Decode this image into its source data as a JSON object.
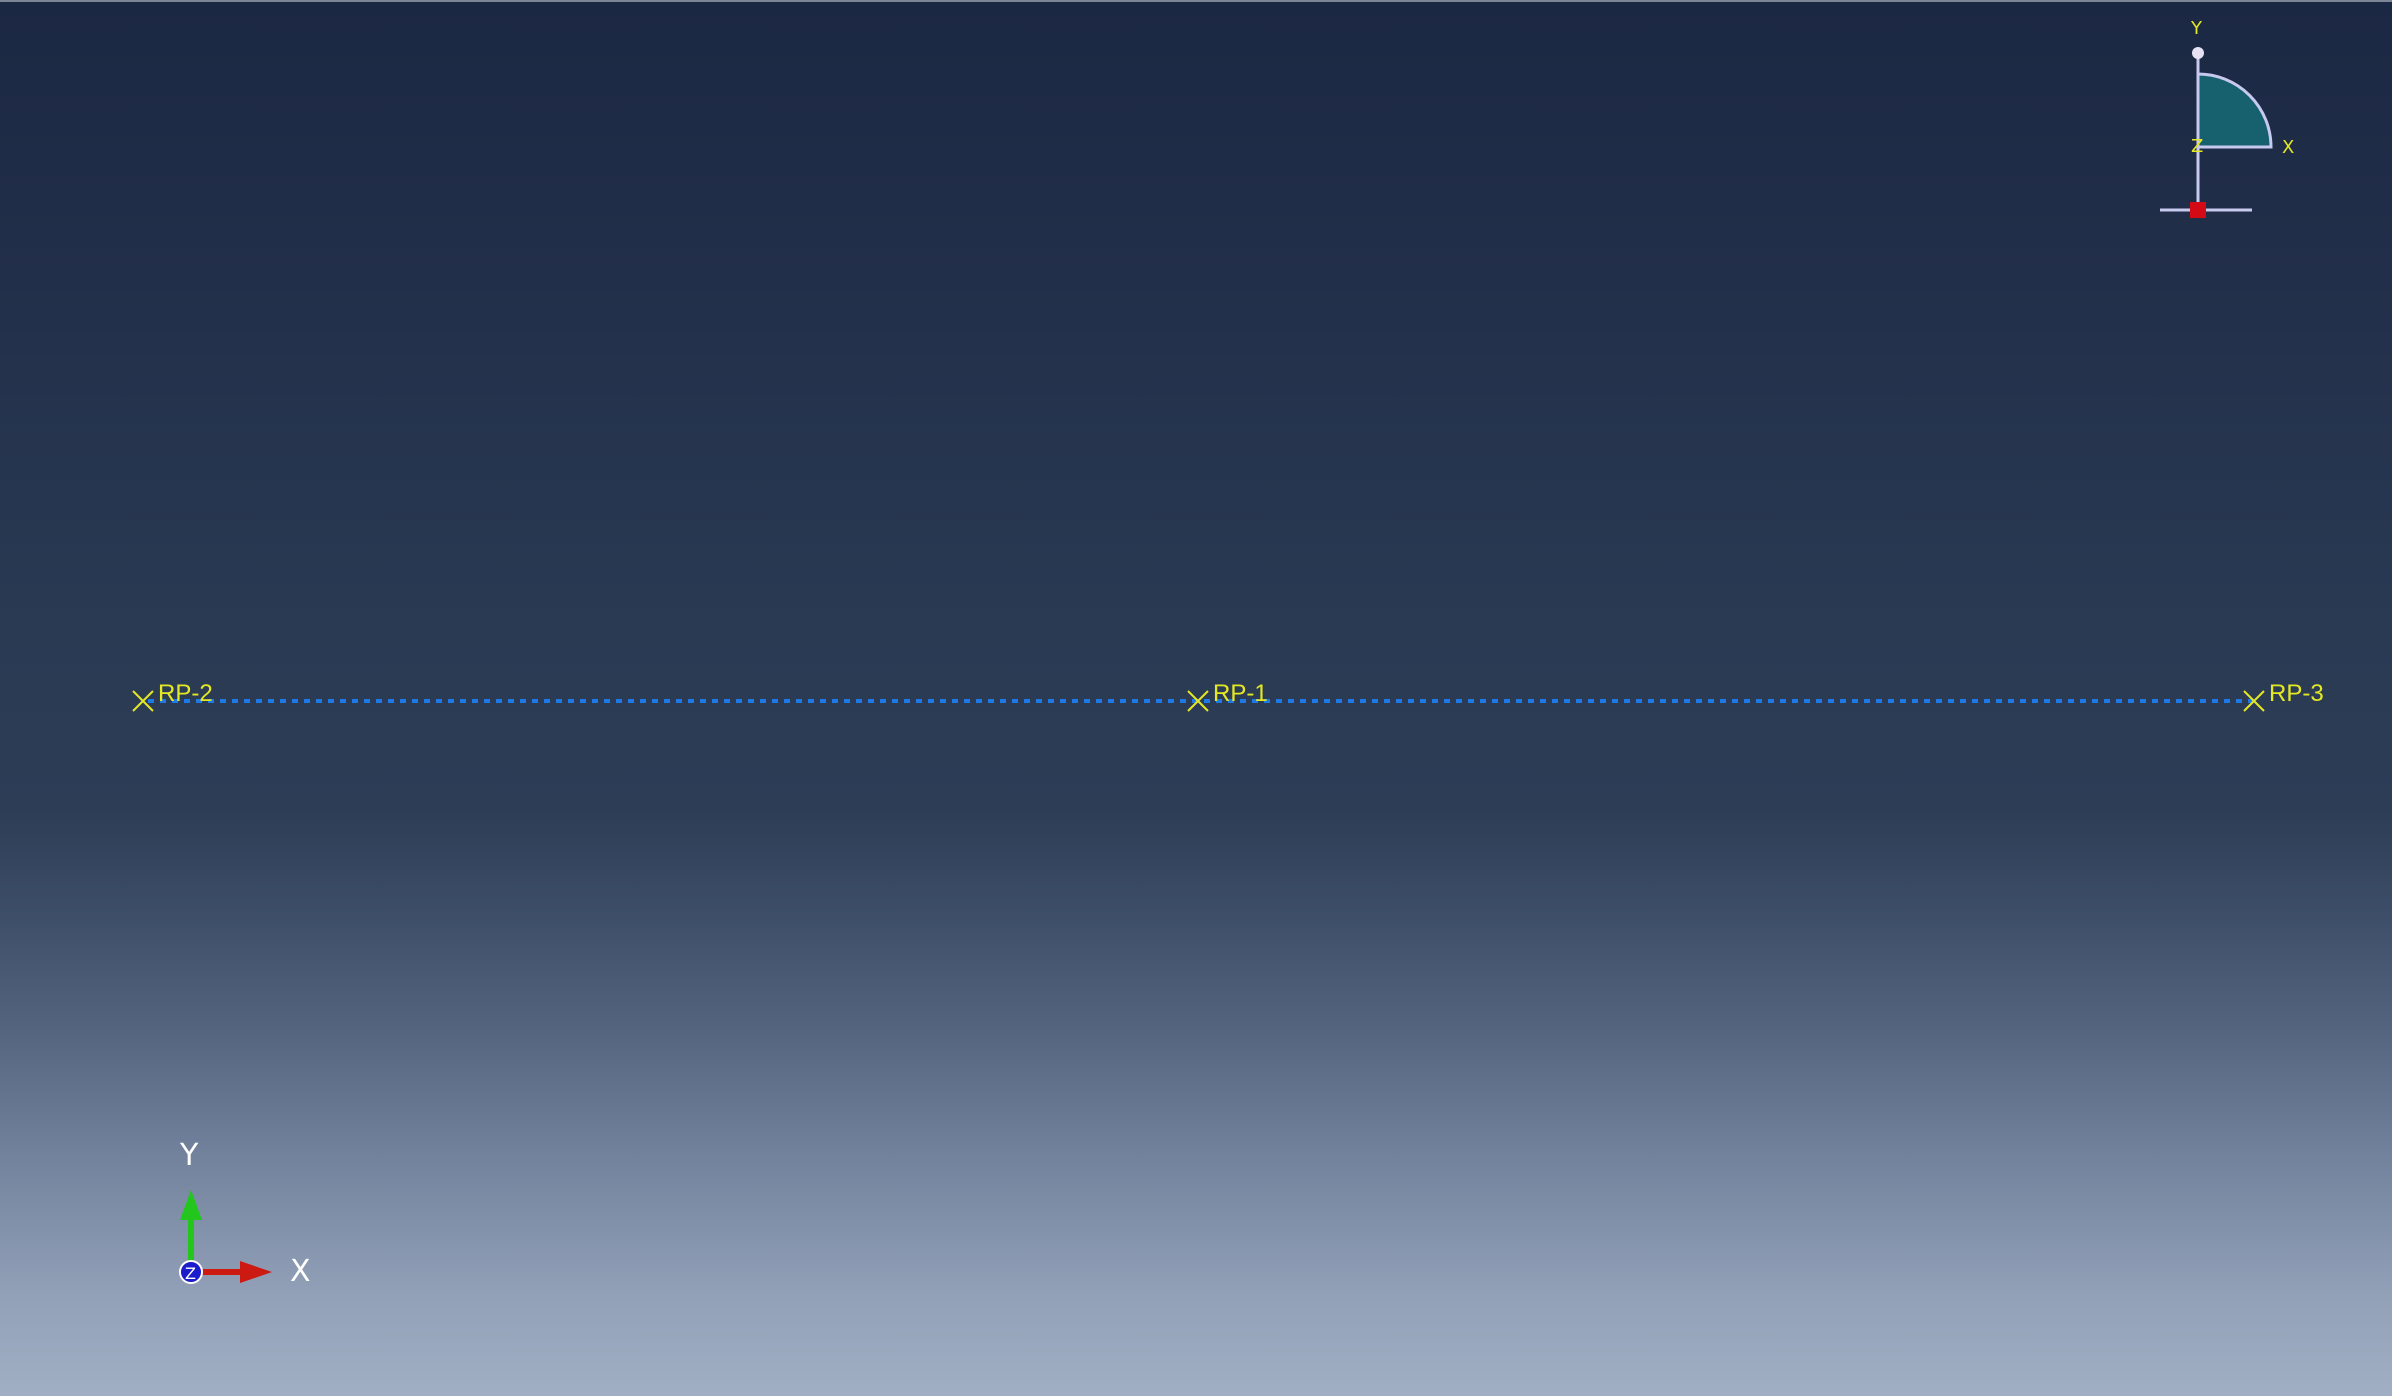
{
  "viewport": {
    "background_top": "#1b2843",
    "background_bottom": "#a1afc4"
  },
  "colors": {
    "marker": "#e4e824",
    "connector": "#1e78e6",
    "x_axis": "#cc1a12",
    "y_axis": "#22c61c",
    "z_axis": "#1b1ccc",
    "sketch_fill": "#17606e",
    "sketch_outline": "#c7c9ee",
    "origin_marker": "#d40a14"
  },
  "reference_points": [
    {
      "id": "rp2",
      "label": "RP-2"
    },
    {
      "id": "rp1",
      "label": "RP-1"
    },
    {
      "id": "rp3",
      "label": "RP-3"
    }
  ],
  "connector": {
    "style": "dotted"
  },
  "triad": {
    "x_label": "X",
    "y_label": "Y",
    "z_label": "Z"
  },
  "mini_view": {
    "y_label": "Y",
    "x_label": "X",
    "z_label": "Z"
  }
}
